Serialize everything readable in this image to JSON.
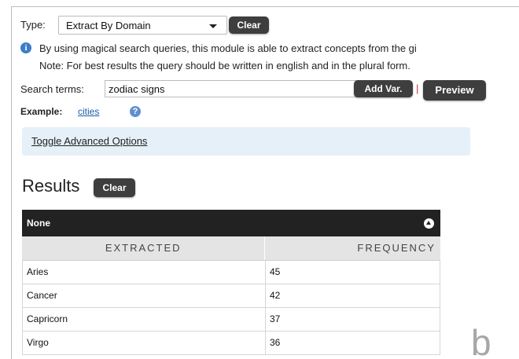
{
  "type_label": "Type:",
  "type_select": {
    "value": "Extract By Domain"
  },
  "clear_top_label": "Clear",
  "info": {
    "line1": "By using magical search queries, this module is able to extract concepts from the gi",
    "line2": "Note: For best results the query should be written in english and in the plural form."
  },
  "search": {
    "label": "Search terms:",
    "value": "zodiac signs",
    "add_var_label": "Add Var.",
    "separator": "|",
    "preview_label": "Preview"
  },
  "example": {
    "label": "Example:",
    "link": "cities"
  },
  "advanced": {
    "toggle_label": "Toggle Advanced Options"
  },
  "results": {
    "title": "Results",
    "clear_label": "Clear",
    "group_title": "None",
    "columns": [
      "EXTRACTED",
      "FREQUENCY"
    ],
    "rows": [
      {
        "term": "Aries",
        "freq": "45"
      },
      {
        "term": "Cancer",
        "freq": "42"
      },
      {
        "term": "Capricorn",
        "freq": "37"
      },
      {
        "term": "Virgo",
        "freq": "36"
      }
    ]
  },
  "panel_label": "b",
  "colors": {
    "button_dark": "#3e3e3e",
    "table_header": "#222222",
    "advanced_bg": "#e6f0f8",
    "link": "#1a5ea8",
    "info_icon": "#3d7cc9"
  },
  "icons": [
    "info-icon",
    "help-icon",
    "chevron-down-icon",
    "collapse-icon"
  ]
}
